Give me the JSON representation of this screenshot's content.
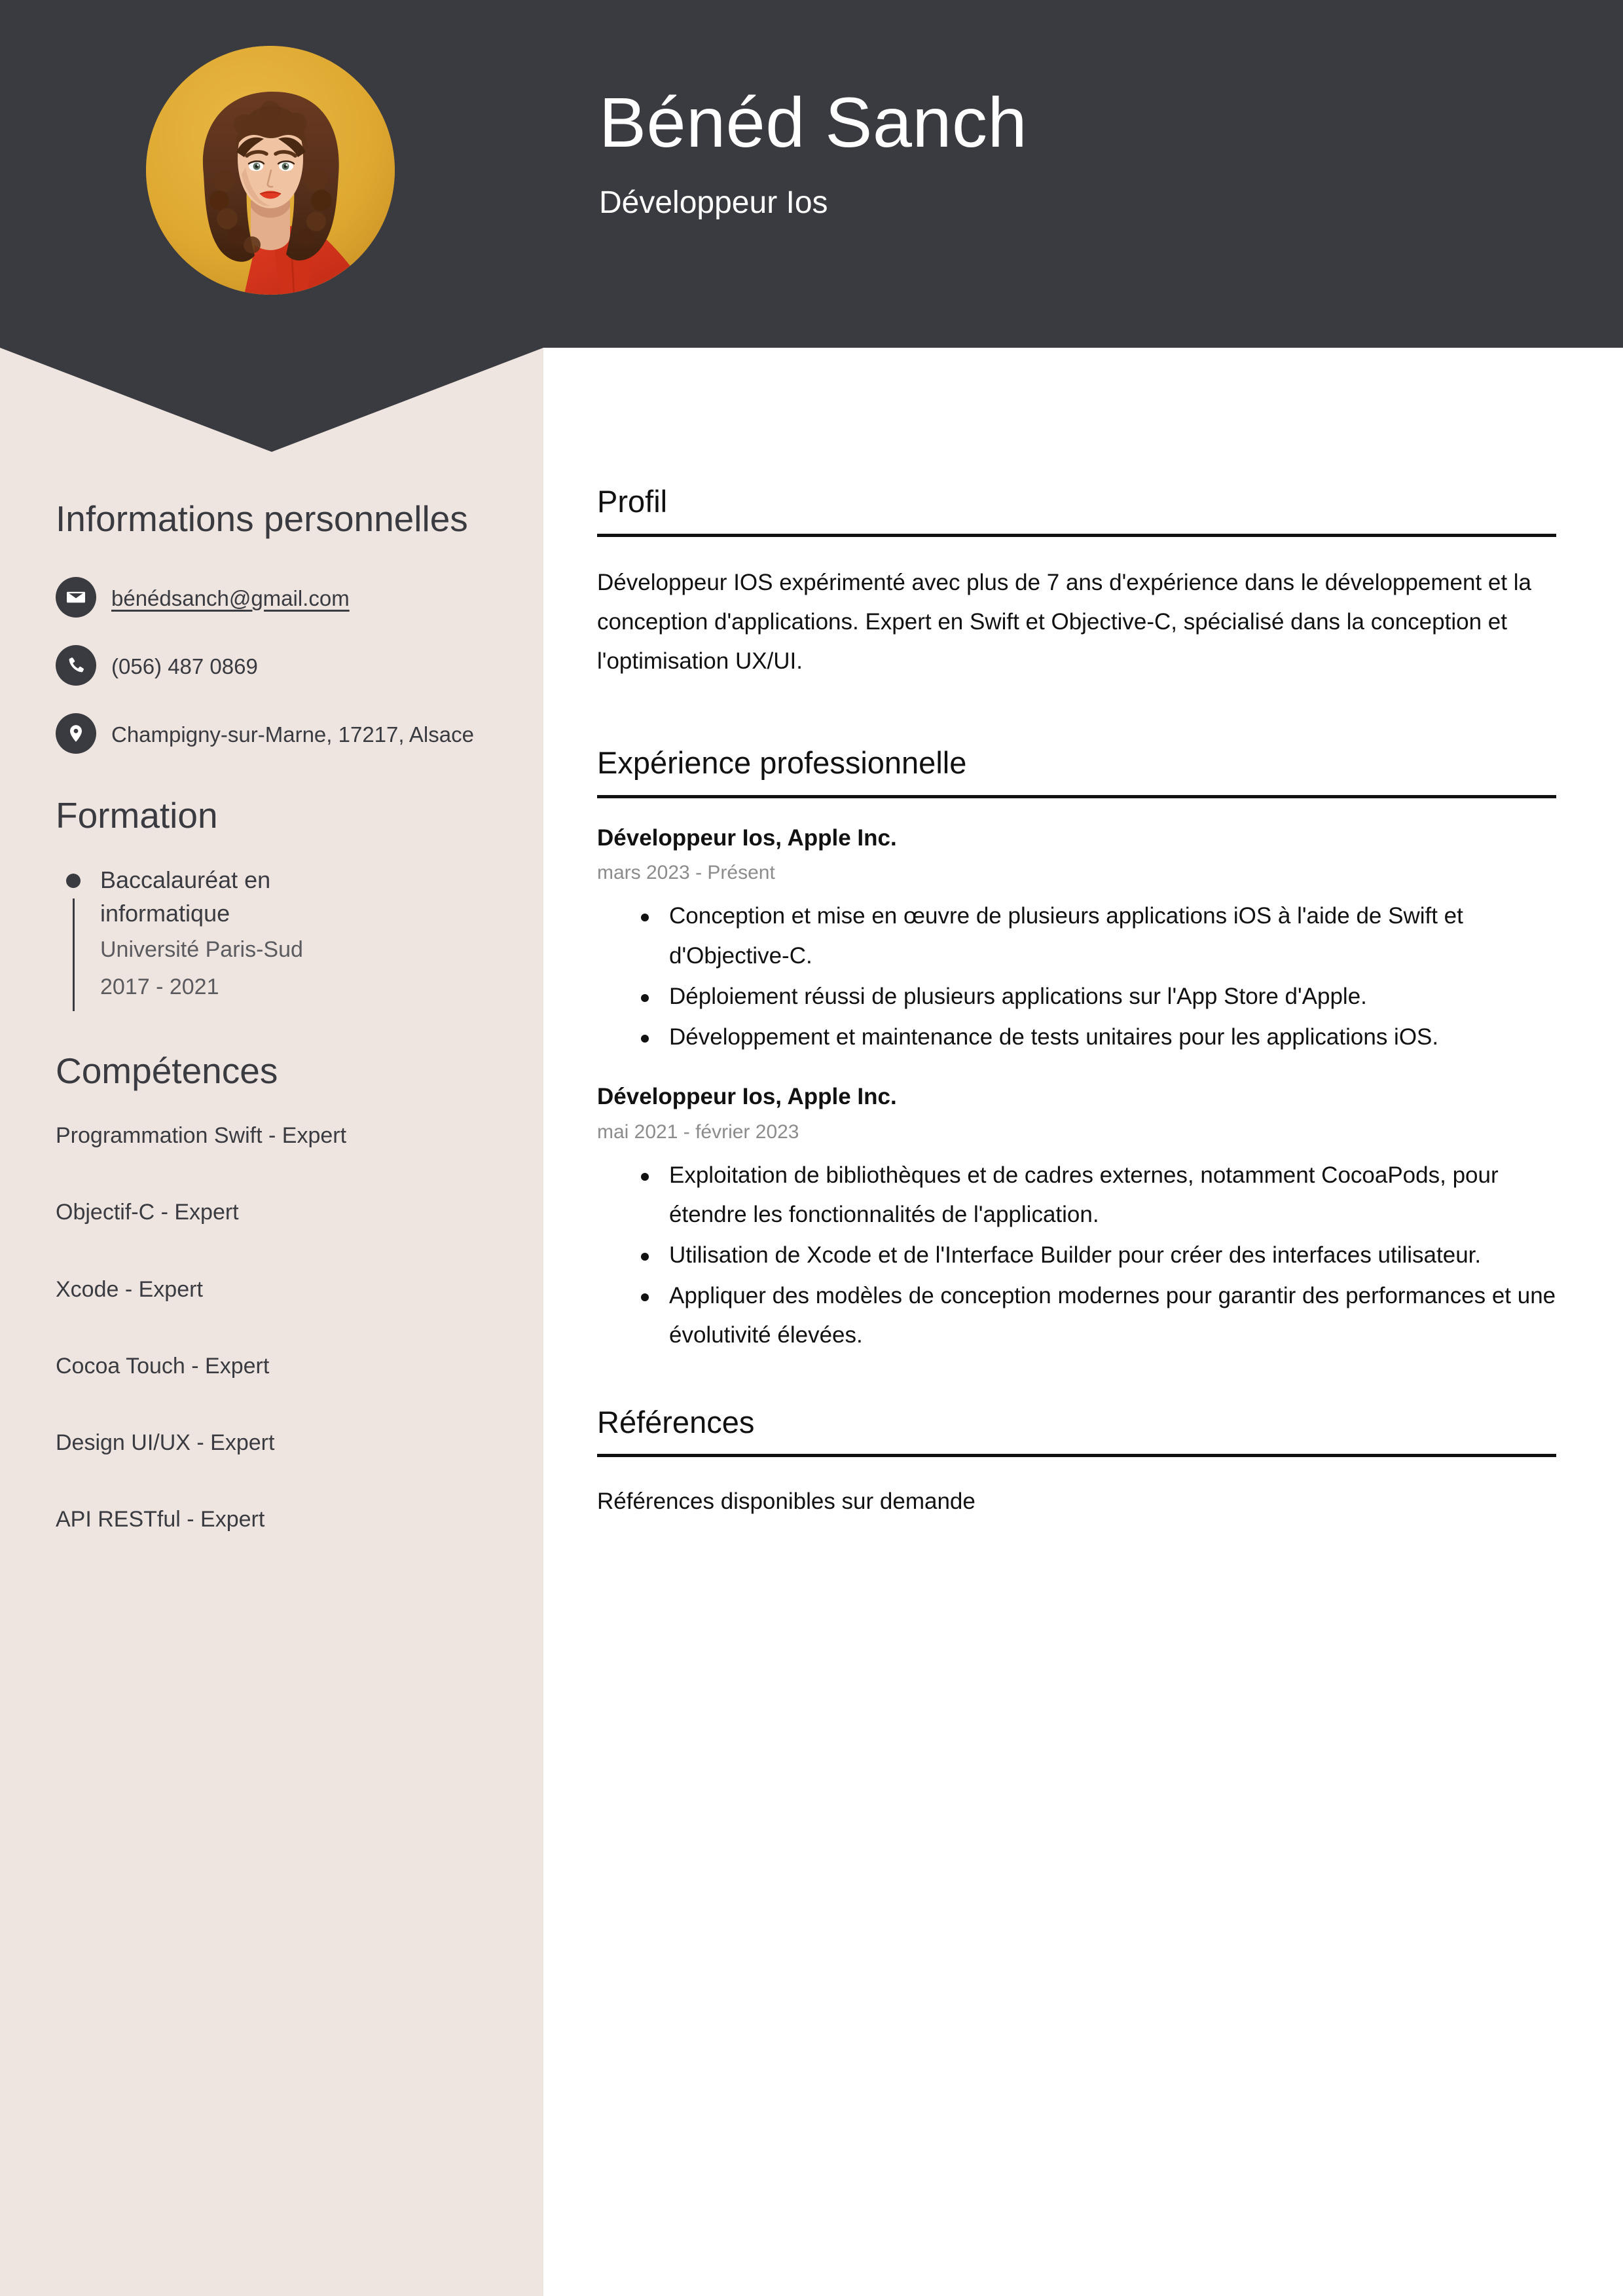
{
  "header": {
    "full_name": "Bénéd Sanch",
    "job_title": "Développeur Ios",
    "background_color": "#3A3B40",
    "avatar_background_color": "#E0A832",
    "avatar_alt": "portrait-photo"
  },
  "sidebar": {
    "background_color": "#EEE5E0",
    "personal": {
      "heading": "Informations personnelles",
      "contacts": [
        {
          "icon": "envelope-icon",
          "value": "bénédsanch@gmail.com",
          "is_link": true
        },
        {
          "icon": "phone-icon",
          "value": "(056) 487 0869",
          "is_link": false
        },
        {
          "icon": "location-pin-icon",
          "value": "Champigny-sur-Marne, 17217, Alsace",
          "is_link": false
        }
      ]
    },
    "formation": {
      "heading": "Formation",
      "items": [
        {
          "degree": "Baccalauréat en informatique",
          "school": "Université Paris-Sud",
          "dates": "2017 - 2021"
        }
      ]
    },
    "skills": {
      "heading": "Compétences",
      "items": [
        "Programmation Swift - Expert",
        "Objectif-C - Expert",
        "Xcode - Expert",
        "Cocoa Touch - Expert",
        "Design UI/UX - Expert",
        "API RESTful - Expert"
      ]
    }
  },
  "main": {
    "profile": {
      "heading": "Profil",
      "text": "Développeur IOS expérimenté avec plus de 7 ans d'expérience dans le développement et la conception d'applications. Expert en Swift et Objective-C, spécialisé dans la conception et l'optimisation UX/UI."
    },
    "experience": {
      "heading": "Expérience professionnelle",
      "jobs": [
        {
          "title": "Développeur Ios, Apple Inc.",
          "dates": "mars 2023 - Présent",
          "bullets": [
            "Conception et mise en œuvre de plusieurs applications iOS à l'aide de Swift et d'Objective-C.",
            "Déploiement réussi de plusieurs applications sur l'App Store d'Apple.",
            "Développement et maintenance de tests unitaires pour les applications iOS."
          ]
        },
        {
          "title": "Développeur Ios, Apple Inc.",
          "dates": "mai 2021 - février 2023",
          "bullets": [
            "Exploitation de bibliothèques et de cadres externes, notamment CocoaPods, pour étendre les fonctionnalités de l'application.",
            "Utilisation de Xcode et de l'Interface Builder pour créer des interfaces utilisateur.",
            "Appliquer des modèles de conception modernes pour garantir des performances et une évolutivité élevées."
          ]
        }
      ]
    },
    "references": {
      "heading": "Références",
      "text": "Références disponibles sur demande"
    }
  }
}
